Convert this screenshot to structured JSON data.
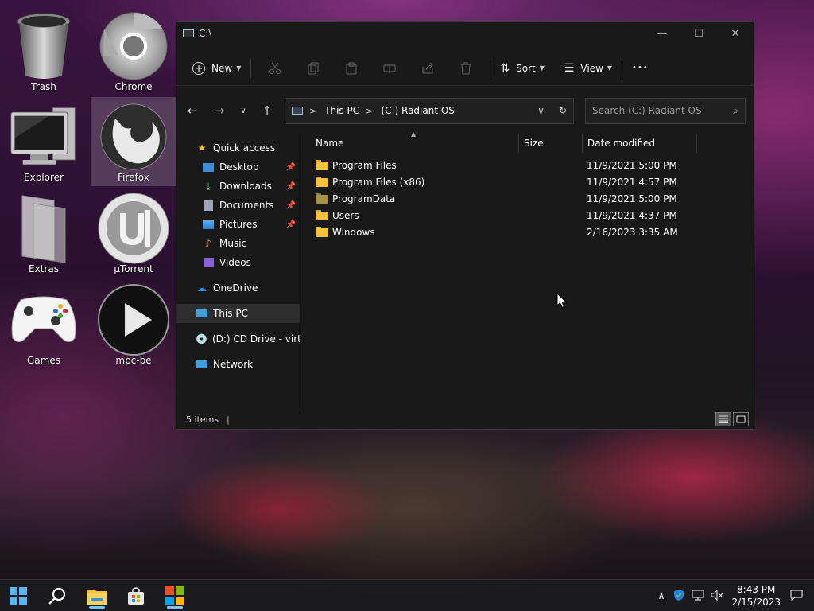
{
  "desktop": {
    "icons": [
      {
        "label": "Trash"
      },
      {
        "label": "Chrome"
      },
      {
        "label": "Explorer"
      },
      {
        "label": "Firefox"
      },
      {
        "label": "Extras"
      },
      {
        "label": "µTorrent"
      },
      {
        "label": "Games"
      },
      {
        "label": "mpc-be"
      }
    ]
  },
  "window": {
    "title": "C:\\",
    "controls": {
      "minimize": "—",
      "maximize": "☐",
      "close": "✕"
    },
    "toolbar": {
      "new_label": "New",
      "sort_label": "Sort",
      "view_label": "View",
      "more_label": "•••"
    },
    "address": {
      "crumbs": [
        "This PC",
        "(C:) Radiant OS"
      ],
      "separator": ">"
    },
    "search": {
      "placeholder": "Search (C:) Radiant OS"
    },
    "nav": {
      "quick_access": "Quick access",
      "desktop": "Desktop",
      "downloads": "Downloads",
      "documents": "Documents",
      "pictures": "Pictures",
      "music": "Music",
      "videos": "Videos",
      "onedrive": "OneDrive",
      "this_pc": "This PC",
      "cd_drive": "(D:) CD Drive - virtio",
      "network": "Network"
    },
    "columns": {
      "name": "Name",
      "size": "Size",
      "date": "Date modified"
    },
    "files": [
      {
        "name": "Program Files",
        "date": "11/9/2021 5:00 PM"
      },
      {
        "name": "Program Files (x86)",
        "date": "11/9/2021 4:57 PM"
      },
      {
        "name": "ProgramData",
        "date": "11/9/2021 5:00 PM"
      },
      {
        "name": "Users",
        "date": "11/9/2021 4:37 PM"
      },
      {
        "name": "Windows",
        "date": "2/16/2023 3:35 AM"
      }
    ],
    "status": {
      "item_count": "5 items"
    }
  },
  "taskbar": {
    "time": "8:43 PM",
    "date": "2/15/2023"
  },
  "colors": {
    "window_bg": "#191919",
    "folder": "#f5c33b",
    "accent": "#7cc4ff"
  }
}
